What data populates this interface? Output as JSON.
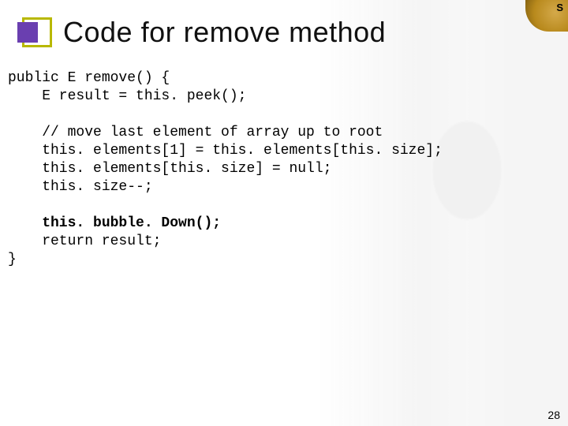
{
  "title": "Code for remove method",
  "page_number": "28",
  "corner_label": "S",
  "code": {
    "l01": "public E remove() {",
    "l02": "    E result = this. peek();",
    "l03": "",
    "l04": "    // move last element of array up to root",
    "l05": "    this. elements[1] = this. elements[this. size];",
    "l06": "    this. elements[this. size] = null;",
    "l07": "    this. size--;",
    "l08": "",
    "l09": "    this. bubble. Down();",
    "l10": "    return result;",
    "l11": "}"
  }
}
